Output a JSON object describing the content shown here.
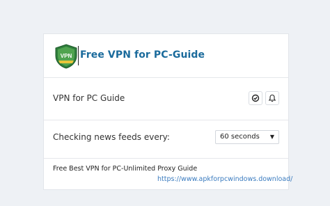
{
  "header": {
    "title": "Free VPN for PC-Guide",
    "logo_text": "VPN"
  },
  "settings": {
    "item_label": "VPN for PC Guide",
    "icons": [
      "check-circle-icon",
      "bell-icon"
    ],
    "feed_label": "Checking news feeds every:",
    "feed_interval": "60 seconds"
  },
  "footer": {
    "description": "Free Best VPN for PC-Unlimited Proxy Guide",
    "link": "https://www.apkforpcwindows.download/"
  },
  "colors": {
    "title": "#1b6b9c",
    "link": "#3a7bbf",
    "background": "#eef1f5"
  }
}
